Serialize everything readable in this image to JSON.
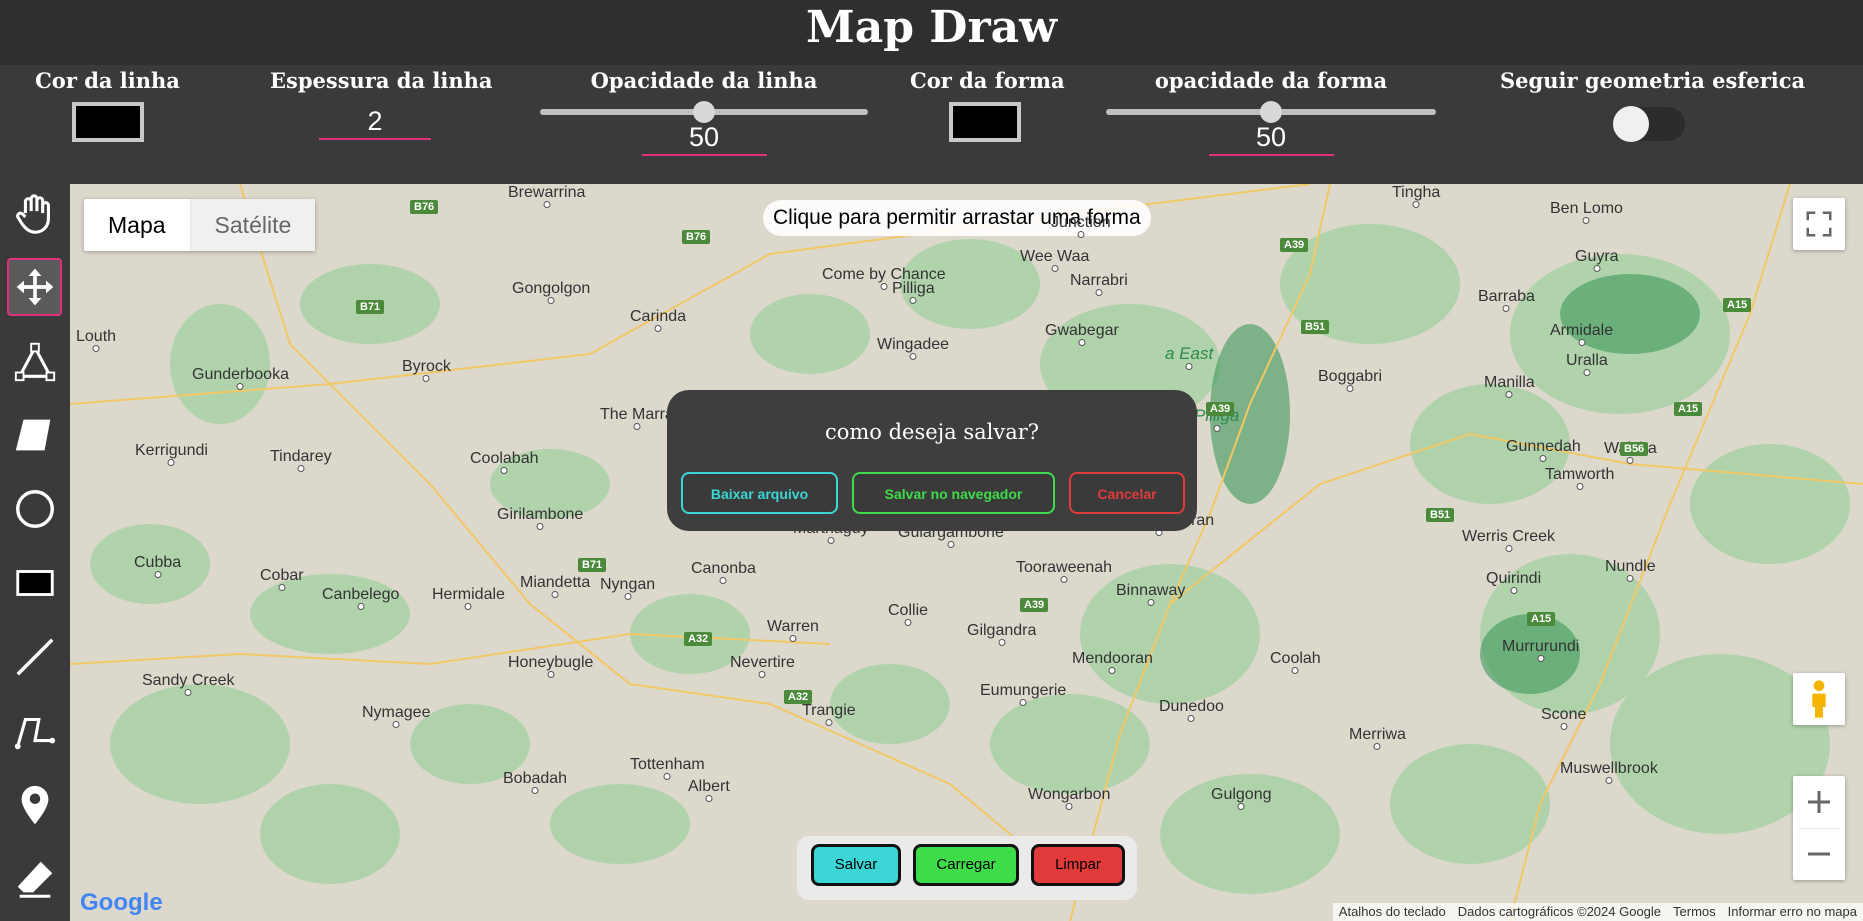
{
  "app": {
    "title": "Map Draw"
  },
  "controls": {
    "line_color_label": "Cor da linha",
    "line_color": "#000000",
    "line_width_label": "Espessura da linha",
    "line_width": "2",
    "line_opacity_label": "Opacidade da linha",
    "line_opacity": "50",
    "line_opacity_fraction": 0.5,
    "shape_color_label": "Cor da forma",
    "shape_color": "#000000",
    "shape_opacity_label": "opacidade da forma",
    "shape_opacity": "50",
    "shape_opacity_fraction": 0.5,
    "geodesic_label": "Seguir geometria esferica",
    "geodesic_on": false
  },
  "tools": [
    {
      "name": "hand-icon"
    },
    {
      "name": "move-icon",
      "active": true
    },
    {
      "name": "drag-shape-icon"
    },
    {
      "name": "polygon-icon"
    },
    {
      "name": "circle-icon"
    },
    {
      "name": "rectangle-icon"
    },
    {
      "name": "line-icon"
    },
    {
      "name": "polyline-icon"
    },
    {
      "name": "marker-icon"
    },
    {
      "name": "eraser-icon"
    }
  ],
  "map": {
    "type_map": "Mapa",
    "type_satellite": "Satélite",
    "hint": "Clique para permitir arrastar uma forma",
    "places": [
      "Brewarrina",
      "Gongolgon",
      "Carinda",
      "Come by Chance",
      "Pilliga",
      "Wee Waa",
      "Narrabri",
      "Tingha",
      "Ben Lomo",
      "Guyra",
      "Barraba",
      "Armidale",
      "Louth",
      "Gunderbooka",
      "Byrock",
      "The Marra",
      "Wingadee",
      "Gwabegar",
      "Boggabri",
      "Manilla",
      "Uralla",
      "Kerrigundi",
      "Tindarey",
      "Coolabah",
      "Gunnedah",
      "Walcha",
      "Tamworth",
      "Girilambone",
      "Marthaguy",
      "Gulargambone",
      "Coonabarabran",
      "Werris Creek",
      "Cubba",
      "Cobar",
      "Canbelego",
      "Hermidale",
      "Miandetta",
      "Nyngan",
      "Canonba",
      "Tooraweenah",
      "Binnaway",
      "Quirindi",
      "Nundle",
      "Warren",
      "Collie",
      "Gilgandra",
      "Sandy Creek",
      "Honeybugle",
      "Nevertire",
      "Mendooran",
      "Coolah",
      "Murrurundi",
      "Nymagee",
      "Eumungerie",
      "Trangie",
      "Dunedoo",
      "Merriwa",
      "Scone",
      "Tottenham",
      "Albert",
      "Bobadah",
      "Wongarbon",
      "Gulgong",
      "Muswellbrook",
      "Junction"
    ],
    "parks": [
      "a East",
      "Pilliga"
    ],
    "roads": [
      "B76",
      "B76",
      "B71",
      "A39",
      "B51",
      "A39",
      "A15",
      "A15",
      "B56",
      "B51",
      "B71",
      "A32",
      "A39",
      "A32",
      "A15"
    ],
    "footer": {
      "keyboard": "Atalhos do teclado",
      "data": "Dados cartográficos ©2024 Google",
      "terms": "Termos",
      "report": "Informar erro no mapa"
    },
    "logo": "Google"
  },
  "dialog": {
    "question": "como deseja salvar?",
    "download": "Baixar arquivo",
    "browser": "Salvar no navegador",
    "cancel": "Cancelar"
  },
  "bottom": {
    "save": "Salvar",
    "load": "Carregar",
    "clear": "Limpar"
  },
  "colors": {
    "accent": "#e0307a",
    "cyan": "#3dd6d6",
    "green": "#3fdc4a",
    "red": "#e03a3a"
  }
}
